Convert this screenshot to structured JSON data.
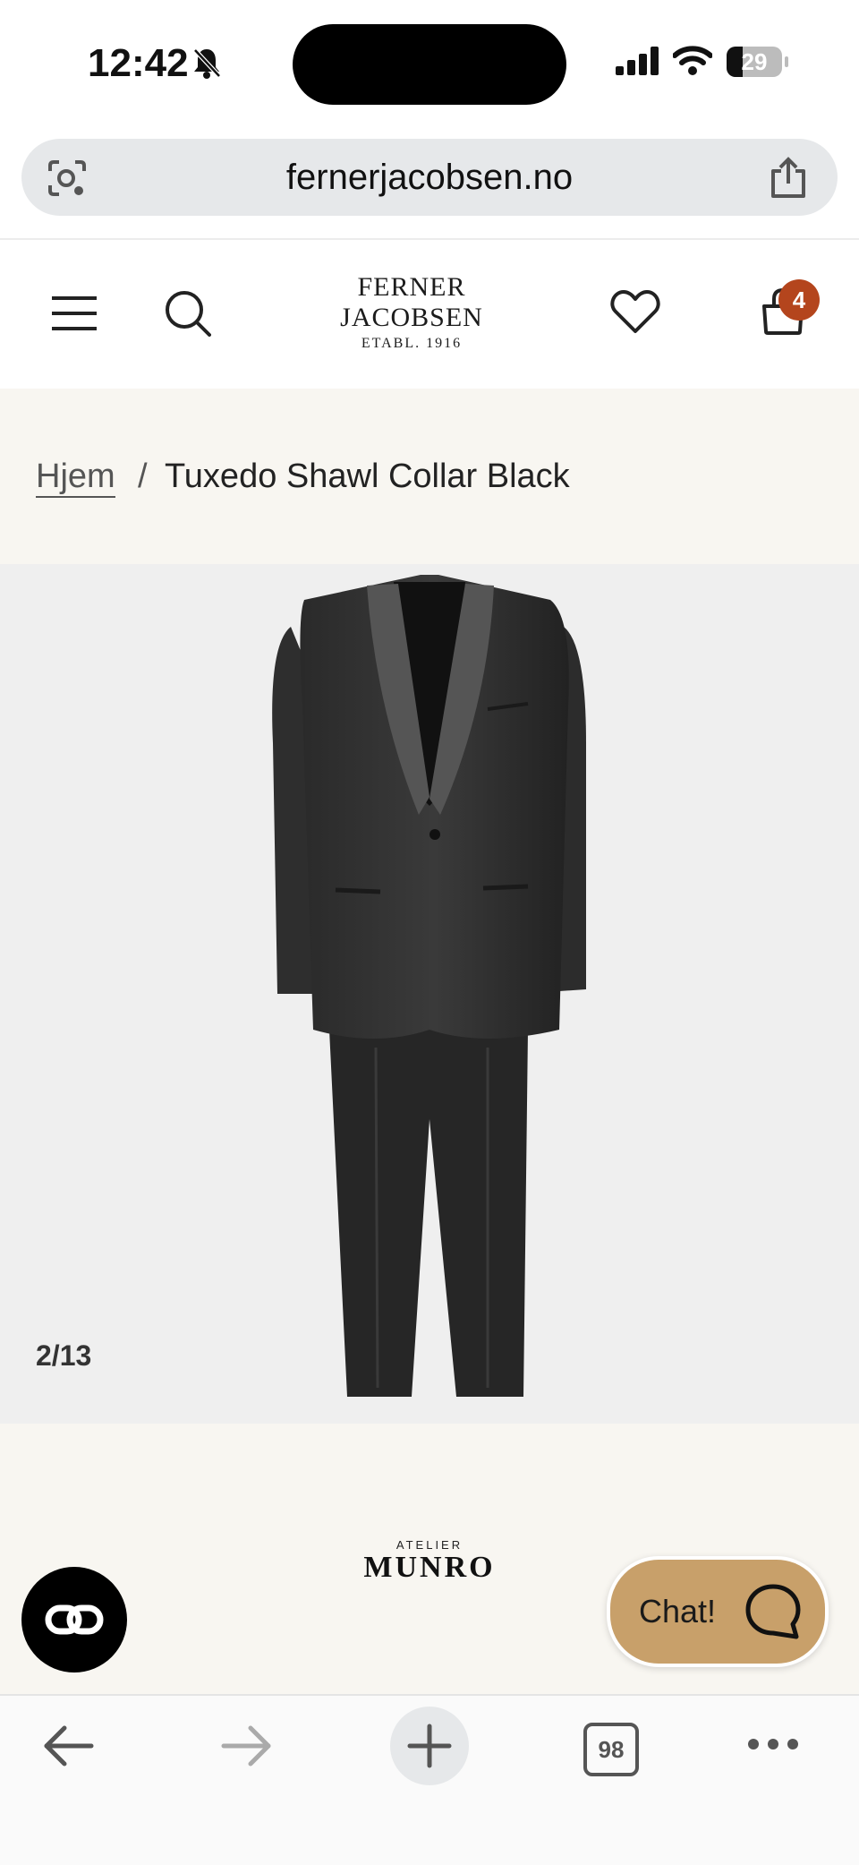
{
  "status_bar": {
    "time": "12:42",
    "battery_level": "29",
    "icons": [
      "bell-slash-icon",
      "cellular-signal-icon",
      "wifi-icon",
      "battery-icon"
    ]
  },
  "browser": {
    "url": "fernerjacobsen.no",
    "tab_count": "98",
    "icons": [
      "visual-search-icon",
      "share-icon",
      "back-arrow-icon",
      "forward-arrow-icon",
      "new-tab-icon",
      "tabs-icon",
      "more-icon"
    ]
  },
  "header": {
    "logo_line1": "FERNER",
    "logo_line2": "JACOBSEN",
    "logo_line3": "ETABL. 1916",
    "cart_count": "4",
    "icons": [
      "menu-icon",
      "search-icon",
      "heart-icon",
      "bag-icon"
    ]
  },
  "breadcrumb": {
    "home": "Hjem",
    "separator": "/",
    "current": "Tuxedo Shawl Collar Black"
  },
  "gallery": {
    "counter": "2/13"
  },
  "brand": {
    "small": "ATELIER",
    "big": "MUNRO"
  },
  "chat": {
    "label": "Chat!"
  },
  "colors": {
    "accent_badge": "#b4451d",
    "chat_button": "#c8a06a",
    "page_background": "#f8f6f1",
    "image_background": "#efefef"
  }
}
